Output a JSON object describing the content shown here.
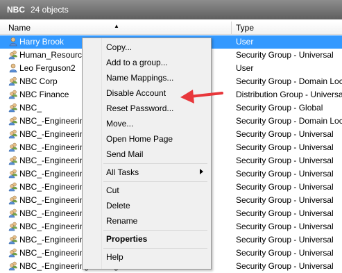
{
  "window": {
    "title": "NBC",
    "object_count": "24 objects"
  },
  "columns": {
    "name": "Name",
    "type": "Type"
  },
  "rows": [
    {
      "name": "Harry Brook",
      "type": "User",
      "kind": "user",
      "selected": true
    },
    {
      "name": "Human_Resource",
      "type": "Security Group - Universal",
      "kind": "group"
    },
    {
      "name": "Leo Ferguson2",
      "type": "User",
      "kind": "user"
    },
    {
      "name": "NBC Corp",
      "type": "Security Group - Domain Local",
      "kind": "group"
    },
    {
      "name": "NBC Finance",
      "type": "Distribution Group - Universal",
      "kind": "group"
    },
    {
      "name": "NBC_",
      "type": "Security Group - Global",
      "kind": "group"
    },
    {
      "name": "NBC_-Engineering",
      "type": "Security Group - Domain Local",
      "kind": "group"
    },
    {
      "name": "NBC_-Engineering",
      "type": "Security Group - Universal",
      "kind": "group"
    },
    {
      "name": "NBC_-Engineering",
      "type": "Security Group - Universal",
      "kind": "group"
    },
    {
      "name": "NBC_-Engineering",
      "type": "Security Group - Universal",
      "kind": "group"
    },
    {
      "name": "NBC_-Engineering",
      "type": "Security Group - Universal",
      "kind": "group"
    },
    {
      "name": "NBC_-Engineering",
      "type": "Security Group - Universal",
      "kind": "group"
    },
    {
      "name": "NBC_-Engineering",
      "type": "Security Group - Universal",
      "kind": "group"
    },
    {
      "name": "NBC_-Engineering",
      "type": "Security Group - Universal",
      "kind": "group"
    },
    {
      "name": "NBC_-Engineering",
      "type": "Security Group - Universal",
      "kind": "group"
    },
    {
      "name": "NBC_-Engineering",
      "type": "Security Group - Universal",
      "kind": "group"
    },
    {
      "name": "NBC_-Engineering",
      "type": "Security Group - Universal",
      "kind": "group"
    },
    {
      "name": "NBC_-Engineering Sr. Engineer",
      "type": "Security Group - Universal",
      "kind": "group"
    }
  ],
  "context_menu": {
    "copy": "Copy...",
    "add_to_group": "Add to a group...",
    "name_mappings": "Name Mappings...",
    "disable_account": "Disable Account",
    "reset_password": "Reset Password...",
    "move": "Move...",
    "open_home_page": "Open Home Page",
    "send_mail": "Send Mail",
    "all_tasks": "All Tasks",
    "cut": "Cut",
    "delete": "Delete",
    "rename": "Rename",
    "properties": "Properties",
    "help": "Help"
  },
  "colors": {
    "selection": "#3399ff",
    "annotation_arrow": "#e8373b",
    "titlebar": "#6e6e6e"
  }
}
